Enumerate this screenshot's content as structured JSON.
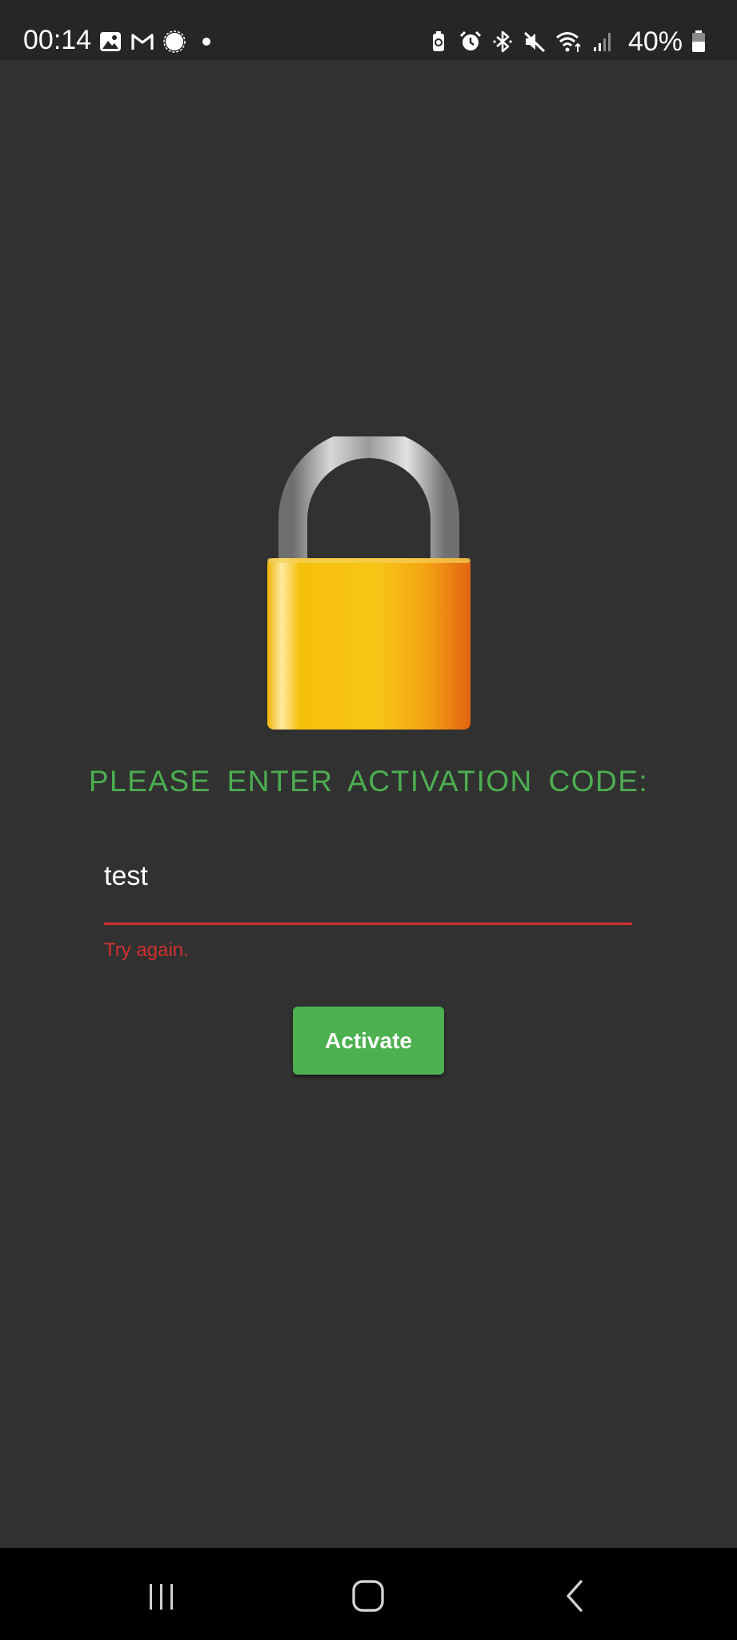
{
  "status_bar": {
    "time": "00:14",
    "battery_percent": "40%",
    "left_icons": [
      "gallery-icon",
      "gmail-icon",
      "signal-messenger-icon",
      "notification-dot-icon"
    ],
    "right_icons": [
      "battery-saver-icon",
      "alarm-icon",
      "bluetooth-icon",
      "mute-icon",
      "wifi-icon",
      "cell-signal-icon",
      "battery-icon"
    ]
  },
  "activation": {
    "lock_icon": "padlock-icon",
    "prompt": "PLEASE ENTER ACTIVATION CODE:",
    "code_value": "test",
    "error": "Try again.",
    "button_label": "Activate"
  },
  "nav_bar": {
    "items": [
      "recent-apps-icon",
      "home-icon",
      "back-icon"
    ]
  },
  "colors": {
    "background": "#313131",
    "status_bar": "#262626",
    "accent_green": "#4caf50",
    "error_red": "#d32f2f",
    "nav_bar": "#000000"
  }
}
